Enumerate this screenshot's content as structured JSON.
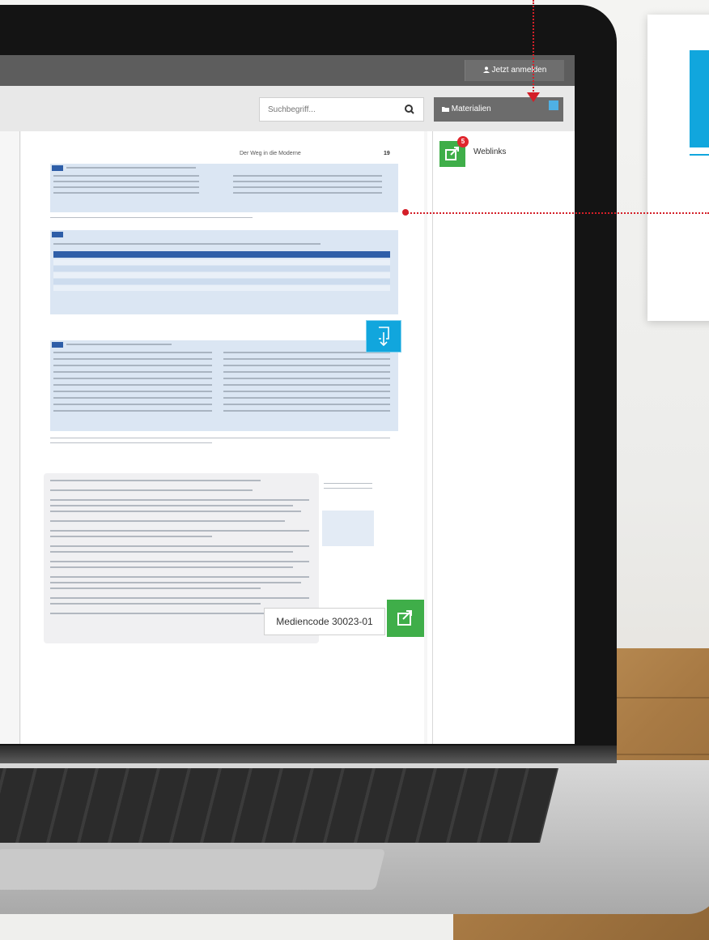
{
  "header": {
    "login_label": "Jetzt anmelden",
    "user_icon": "user-icon"
  },
  "search": {
    "placeholder": "Suchbegriff...",
    "icon": "search-icon"
  },
  "materials": {
    "tab_label": "Materialien",
    "folder_icon": "folder-icon",
    "pin_icon": "pin-icon"
  },
  "sidebar": {
    "weblinks_label": "Weblinks",
    "weblinks_badge": "5"
  },
  "page": {
    "running_head": "Der Weg in die Moderne",
    "page_number": "19"
  },
  "mediencode": {
    "label": "Mediencode 30023-01"
  },
  "colors": {
    "accent_blue": "#11a6dd",
    "accent_green": "#3fae49",
    "annotation_red": "#d41f28",
    "header_gray": "#5d5d5d"
  }
}
